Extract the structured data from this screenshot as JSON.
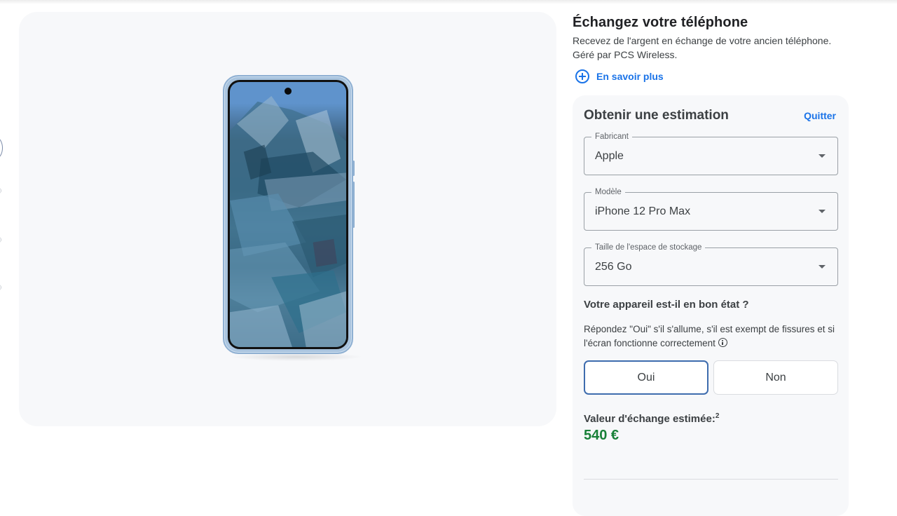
{
  "trade_in": {
    "title": "Échangez votre téléphone",
    "description": "Recevez de l'argent en échange de votre ancien téléphone. Géré par PCS Wireless.",
    "learn_more": "En savoir plus",
    "learn_more_icon": "plus-circle-icon"
  },
  "estimate": {
    "title": "Obtenir une estimation",
    "quit": "Quitter",
    "fields": [
      {
        "label": "Fabricant",
        "value": "Apple"
      },
      {
        "label": "Modèle",
        "value": "iPhone 12 Pro Max"
      },
      {
        "label": "Taille de l'espace de stockage",
        "value": "256 Go"
      }
    ],
    "condition": {
      "question": "Votre appareil est-il en bon état ?",
      "description": "Répondez \"Oui\" s'il s'allume, s'il est exempt de fissures et si l'écran fonctionne correctement",
      "options": [
        {
          "label": "Oui",
          "selected": true
        },
        {
          "label": "Non",
          "selected": false
        }
      ]
    },
    "value_label": "Valeur d'échange estimée:",
    "value_footnote": "2",
    "value_amount": "540 €"
  },
  "product_image": {
    "alt": "Google Pixel 8 Pro bleu, vue de face"
  },
  "colors": {
    "accent": "#1a73e8",
    "selected_border": "#3e6cae",
    "price_green": "#188038",
    "panel_bg": "#f7f8fa"
  }
}
